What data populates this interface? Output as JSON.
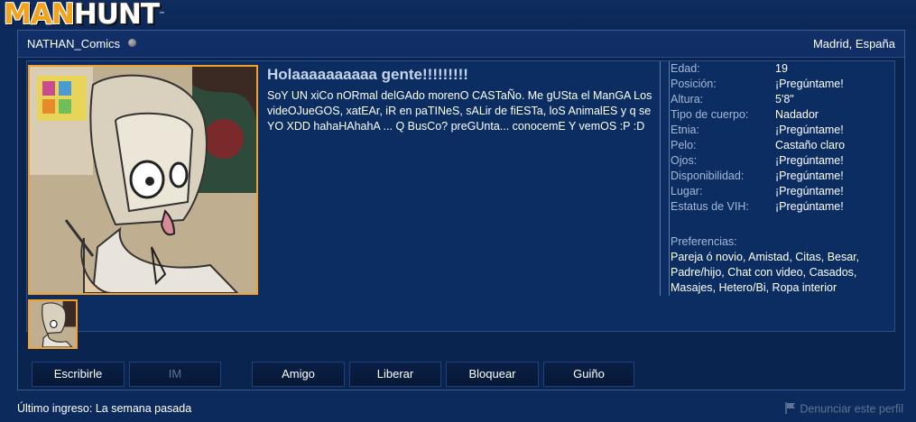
{
  "logo": {
    "part1": "MAN",
    "part2": "HUNT",
    "tm": "™"
  },
  "profile": {
    "username": "NATHAN_Comics",
    "location": "Madrid, España",
    "headline": "Holaaaaaaaaaa gente!!!!!!!!!",
    "bio": "SoY UN xiCo nORmal delGAdo morenO CASTaÑo. Me gUSta el ManGA Los videOJueGOS, xatEAr, iR en paTINeS, sALir de fiESTa, loS AnimalES y q se YO XDD hahaHAhahA ... Q BusCo? preGUnta... conocemE Y vemOS :P :D"
  },
  "stats": [
    {
      "label": "Edad:",
      "value": "19"
    },
    {
      "label": "Posición:",
      "value": "¡Pregúntame!"
    },
    {
      "label": "Altura:",
      "value": "5'8\""
    },
    {
      "label": "Tipo de cuerpo:",
      "value": "Nadador"
    },
    {
      "label": "Etnia:",
      "value": "¡Pregúntame!"
    },
    {
      "label": "Pelo:",
      "value": "Castaño claro"
    },
    {
      "label": "Ojos:",
      "value": "¡Pregúntame!"
    },
    {
      "label": "Disponibilidad:",
      "value": "¡Pregúntame!"
    },
    {
      "label": "Lugar:",
      "value": "¡Pregúntame!"
    },
    {
      "label": "Estatus de VIH:",
      "value": "¡Pregúntame!"
    }
  ],
  "preferences": {
    "label": "Preferencias:",
    "text": "Pareja ó novio, Amistad, Citas, Besar, Padre/hijo, Chat con video, Casados, Masajes, Hetero/Bi, Ropa interior"
  },
  "buttons": {
    "write": "Escribirle",
    "im": "IM",
    "friend": "Amigo",
    "release": "Liberar",
    "block": "Bloquear",
    "wink": "Guiño"
  },
  "footer": {
    "last_login": "Último ingreso: La semana pasada",
    "report": "Denunciar este perfil"
  },
  "colors": {
    "background": "#0d2a5c",
    "accent": "#f3a12a",
    "label": "#a6b8d6",
    "headline": "#c6d4ea"
  }
}
